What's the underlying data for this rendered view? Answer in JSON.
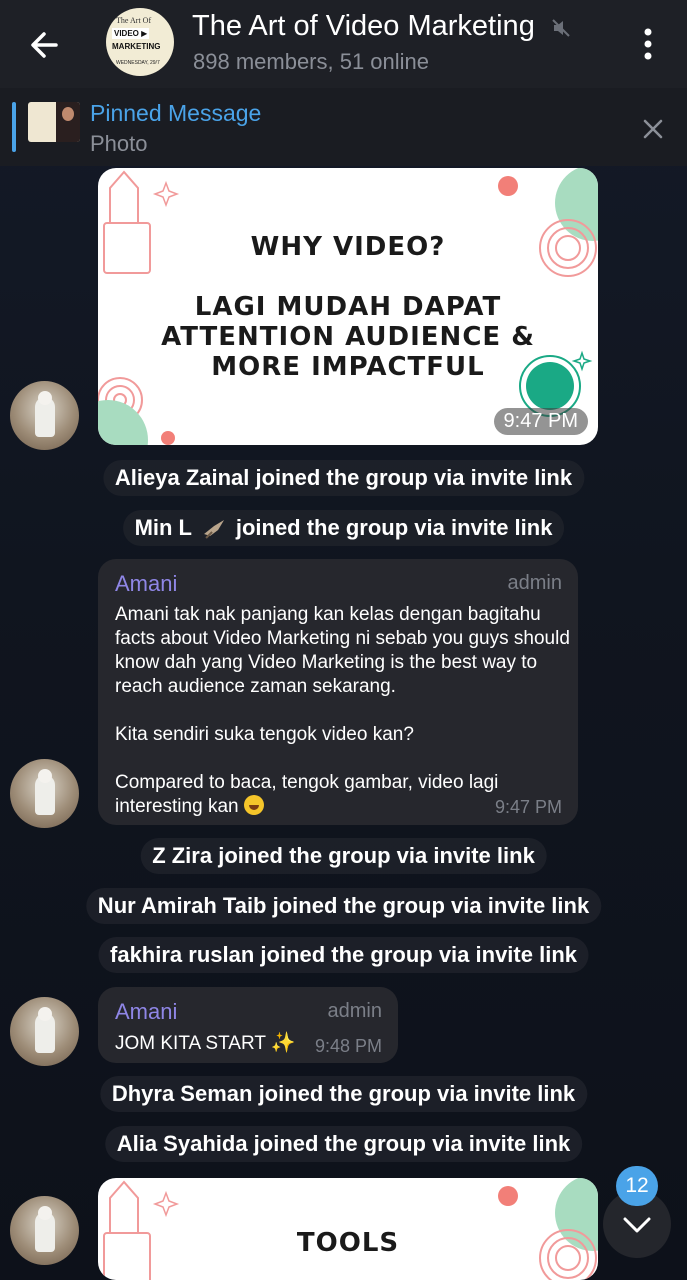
{
  "header": {
    "title": "The Art of Video Marketing",
    "subtitle": "898 members, 51 online",
    "avatar_lines": [
      "The Art Of",
      "VIDEO ▶",
      "MARKETING",
      "WEDNESDAY, 29/7"
    ]
  },
  "pinned": {
    "title": "Pinned Message",
    "subtitle": "Photo"
  },
  "messages": {
    "post1": {
      "line1": "WHY VIDEO?",
      "line2": "LAGI MUDAH DAPAT",
      "line3": "ATTENTION AUDIENCE &",
      "line4": "MORE IMPACTFUL",
      "time": "9:47 PM"
    },
    "svc1": "Alieya Zainal joined the group via invite link",
    "svc2_name": "Min L",
    "svc2_rest": "joined the group via invite link",
    "bubble1": {
      "sender": "Amani",
      "role": "admin",
      "p1": "Amani tak nak panjang kan kelas dengan bagitahu facts about Video Marketing ni sebab you guys should know dah yang Video Marketing is the best way to reach audience zaman sekarang.",
      "p2": "Kita sendiri suka tengok video kan?",
      "p3": "Compared to baca, tengok gambar, video lagi interesting kan",
      "time": "9:47 PM"
    },
    "svc3": "Z Zira joined the group via invite link",
    "svc4": "Nur Amirah Taib joined the group via invite link",
    "svc5": "fakhira ruslan joined the group via invite link",
    "bubble2": {
      "sender": "Amani",
      "role": "admin",
      "text": "JOM KITA START",
      "time": "9:48 PM"
    },
    "svc6": "Dhyra Seman joined the group via invite link",
    "svc7": "Alia Syahida joined the group via invite link",
    "post2": {
      "line1": "TOOLS"
    }
  },
  "scroll": {
    "unread_count": "12"
  },
  "colors": {
    "accent": "#4aa3e8",
    "sender": "#8f86e6",
    "header_bg": "#1e2026",
    "bubble_bg": "#26272d"
  }
}
